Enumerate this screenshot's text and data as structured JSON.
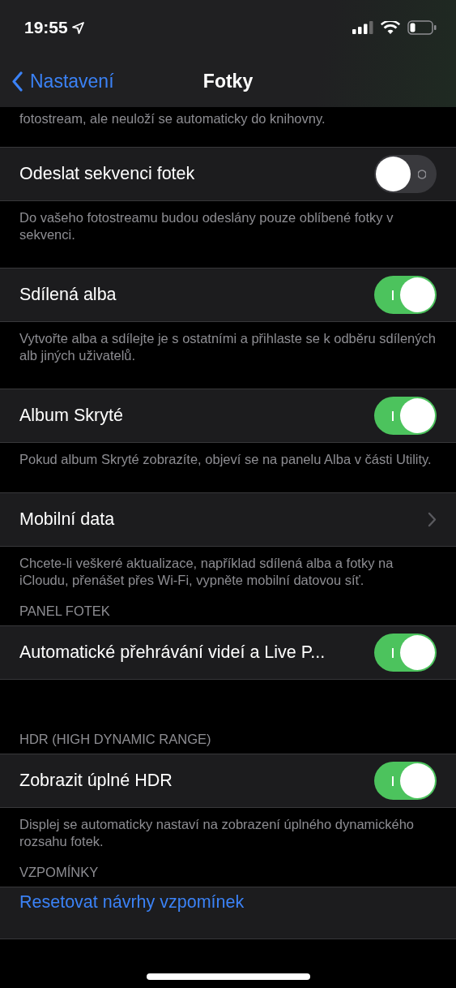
{
  "status_bar": {
    "time": "19:55"
  },
  "nav": {
    "back": "Nastavení",
    "title": "Fotky"
  },
  "sections": [
    {
      "footer": "fotostream, ale neuloží se automaticky do knihovny."
    },
    {
      "rows": [
        {
          "kind": "toggle",
          "label": "Odeslat sekvenci fotek",
          "on": false
        }
      ],
      "footer": "Do vašeho fotostreamu budou odeslány pouze oblíbené fotky v sekvenci."
    },
    {
      "rows": [
        {
          "kind": "toggle",
          "label": "Sdílená alba",
          "on": true
        }
      ],
      "footer": "Vytvořte alba a sdílejte je s ostatními a přihlaste se k odběru sdílených alb jiných uživatelů."
    },
    {
      "rows": [
        {
          "kind": "toggle",
          "label": "Album Skryté",
          "on": true
        }
      ],
      "footer": "Pokud album Skryté zobrazíte, objeví se na panelu Alba v části Utility."
    },
    {
      "rows": [
        {
          "kind": "disclosure",
          "label": "Mobilní data"
        }
      ],
      "footer": "Chcete-li veškeré aktualizace, například sdílená alba a fotky na iCloudu, přenášet přes Wi-Fi, vypněte mobilní datovou síť."
    },
    {
      "header": "PANEL FOTEK",
      "rows": [
        {
          "kind": "toggle",
          "label": "Automatické přehrávání videí a Live P...",
          "on": true
        }
      ]
    },
    {
      "header": "HDR (HIGH DYNAMIC RANGE)",
      "rows": [
        {
          "kind": "toggle",
          "label": "Zobrazit úplné HDR",
          "on": true
        }
      ],
      "footer": "Displej se automaticky nastaví na zobrazení úplného dynamického rozsahu fotek."
    },
    {
      "header": "VZPOMÍNKY",
      "rows": [
        {
          "kind": "action",
          "label": "Resetovat návrhy vzpomínek"
        }
      ]
    }
  ]
}
